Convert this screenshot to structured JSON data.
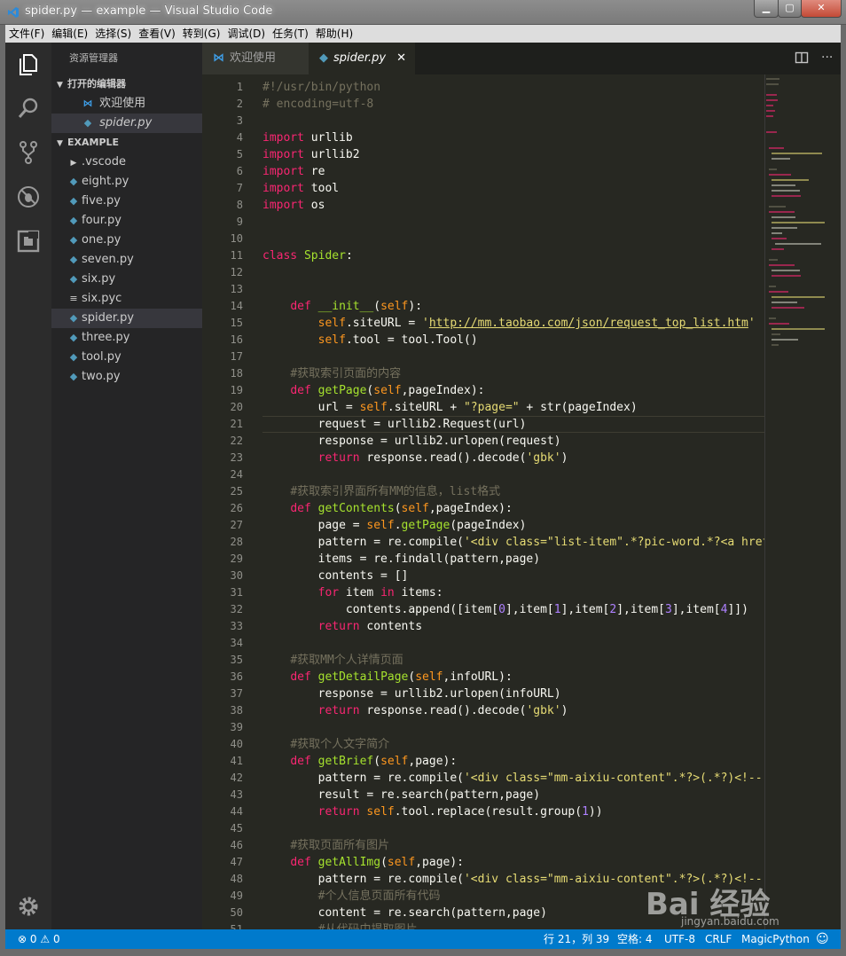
{
  "window": {
    "title": "spider.py — example — Visual Studio Code",
    "min_label": "▁",
    "max_label": "▢",
    "close_label": "✕"
  },
  "menu": [
    "文件(F)",
    "编辑(E)",
    "选择(S)",
    "查看(V)",
    "转到(G)",
    "调试(D)",
    "任务(T)",
    "帮助(H)"
  ],
  "activity_bar": [
    "files-icon",
    "search-icon",
    "source-control-icon",
    "debug-icon",
    "extensions-icon",
    "settings-gear-icon"
  ],
  "sidebar": {
    "title": "资源管理器",
    "open_editors_header": "打开的编辑器",
    "open_editors": [
      {
        "label": "欢迎使用",
        "icon": "vscode-icon"
      },
      {
        "label": "spider.py",
        "icon": "python-icon"
      }
    ],
    "project_header": "EXAMPLE",
    "files": [
      {
        "label": ".vscode",
        "icon": "folder-caret-icon"
      },
      {
        "label": "eight.py",
        "icon": "python-icon"
      },
      {
        "label": "five.py",
        "icon": "python-icon"
      },
      {
        "label": "four.py",
        "icon": "python-icon"
      },
      {
        "label": "one.py",
        "icon": "python-icon"
      },
      {
        "label": "seven.py",
        "icon": "python-icon"
      },
      {
        "label": "six.py",
        "icon": "python-icon"
      },
      {
        "label": "six.pyc",
        "icon": "list-icon"
      },
      {
        "label": "spider.py",
        "icon": "python-icon"
      },
      {
        "label": "three.py",
        "icon": "python-icon"
      },
      {
        "label": "tool.py",
        "icon": "python-icon"
      },
      {
        "label": "two.py",
        "icon": "python-icon"
      }
    ]
  },
  "tabs": {
    "welcome": "欢迎使用",
    "spider": "spider.py",
    "close_glyph": "✕"
  },
  "editor": {
    "line_count": 51,
    "current_line": 21
  },
  "code_lines": [
    "#!/usr/bin/python",
    "# encoding=utf-8",
    "",
    "import urllib",
    "import urllib2",
    "import re",
    "import tool",
    "import os",
    "",
    "",
    "class Spider:",
    "",
    "",
    "    def __init__(self):",
    "        self.siteURL = 'http://mm.taobao.com/json/request_top_list.htm'",
    "        self.tool = tool.Tool()",
    "",
    "    #获取索引页面的内容",
    "    def getPage(self,pageIndex):",
    "        url = self.siteURL + \"?page=\" + str(pageIndex)",
    "        request = urllib2.Request(url)",
    "        response = urllib2.urlopen(request)",
    "        return response.read().decode('gbk')",
    "",
    "    #获取索引界面所有MM的信息，list格式",
    "    def getContents(self,pageIndex):",
    "        page = self.getPage(pageIndex)",
    "        pattern = re.compile('<div class=\"list-item\".*?pic-word.*?<a href=",
    "        items = re.findall(pattern,page)",
    "        contents = []",
    "        for item in items:",
    "            contents.append([item[0],item[1],item[2],item[3],item[4]])",
    "        return contents",
    "",
    "    #获取MM个人详情页面",
    "    def getDetailPage(self,infoURL):",
    "        response = urllib2.urlopen(infoURL)",
    "        return response.read().decode('gbk')",
    "",
    "    #获取个人文字简介",
    "    def getBrief(self,page):",
    "        pattern = re.compile('<div class=\"mm-aixiu-content\".*?>(.*?)<!--',",
    "        result = re.search(pattern,page)",
    "        return self.tool.replace(result.group(1))",
    "",
    "    #获取页面所有图片",
    "    def getAllImg(self,page):",
    "        pattern = re.compile('<div class=\"mm-aixiu-content\".*?>(.*?)<!--',",
    "        #个人信息页面所有代码",
    "        content = re.search(pattern,page)",
    "        #从代码中提取图片"
  ],
  "status": {
    "errors": "0",
    "warnings": "0",
    "position": "行 21，列 39",
    "spaces": "空格: 4",
    "encoding": "UTF-8",
    "eol": "CRLF",
    "language": "MagicPython"
  },
  "watermark": {
    "text": "Bai 经验",
    "sub": "jingyan.baidu.com"
  },
  "colors": {
    "accent": "#007acc",
    "editor_bg": "#272822",
    "sidebar_bg": "#252526"
  }
}
